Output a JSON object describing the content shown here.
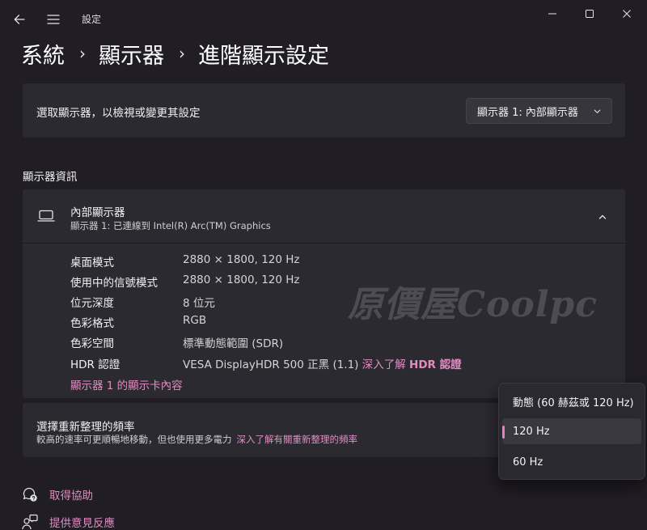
{
  "window": {
    "app_title": "設定"
  },
  "breadcrumb": {
    "items": [
      "系統",
      "顯示器",
      "進階顯示設定"
    ],
    "separator": "›"
  },
  "display_select": {
    "label": "選取顯示器，以檢視或變更其設定",
    "value": "顯示器 1: 內部顯示器"
  },
  "display_info": {
    "section_title": "顯示器資訊",
    "title": "內部顯示器",
    "subtitle": "顯示器 1: 已連線到 Intel(R) Arc(TM) Graphics",
    "rows": [
      {
        "label": "桌面模式",
        "value": "2880 × 1800, 120 Hz"
      },
      {
        "label": "使用中的信號模式",
        "value": "2880 × 1800, 120 Hz"
      },
      {
        "label": "位元深度",
        "value": "8 位元"
      },
      {
        "label": "色彩格式",
        "value": "RGB"
      },
      {
        "label": "色彩空間",
        "value": "標準動態範圍 (SDR)"
      },
      {
        "label": "HDR 認證",
        "value": "VESA DisplayHDR 500 正黑 (1.1)",
        "link": "深入了解",
        "link_bold": "HDR 認證"
      }
    ],
    "adapter_link": "顯示器 1 的顯示卡內容"
  },
  "watermark": "原價屋Coolpc",
  "refresh_rate": {
    "title": "選擇重新整理的頻率",
    "description": "較高的速率可更順暢地移動，但也使用更多電力",
    "link": "深入了解有關重新整理的頻率",
    "options": [
      "動態 (60 赫茲或 120 Hz)",
      "120 Hz",
      "60 Hz"
    ],
    "selected_index": 1
  },
  "footer": {
    "help": "取得協助",
    "feedback": "提供意見反應"
  },
  "colors": {
    "background": "#201d24",
    "card": "#2c2a31",
    "accent": "#e48bc4",
    "indicator": "#e87fc0"
  },
  "icons": [
    "back-arrow-icon",
    "hamburger-menu-icon",
    "minimize-icon",
    "maximize-icon",
    "close-icon",
    "chevron-down-icon",
    "laptop-icon",
    "chevron-up-icon",
    "help-icon",
    "feedback-icon"
  ]
}
